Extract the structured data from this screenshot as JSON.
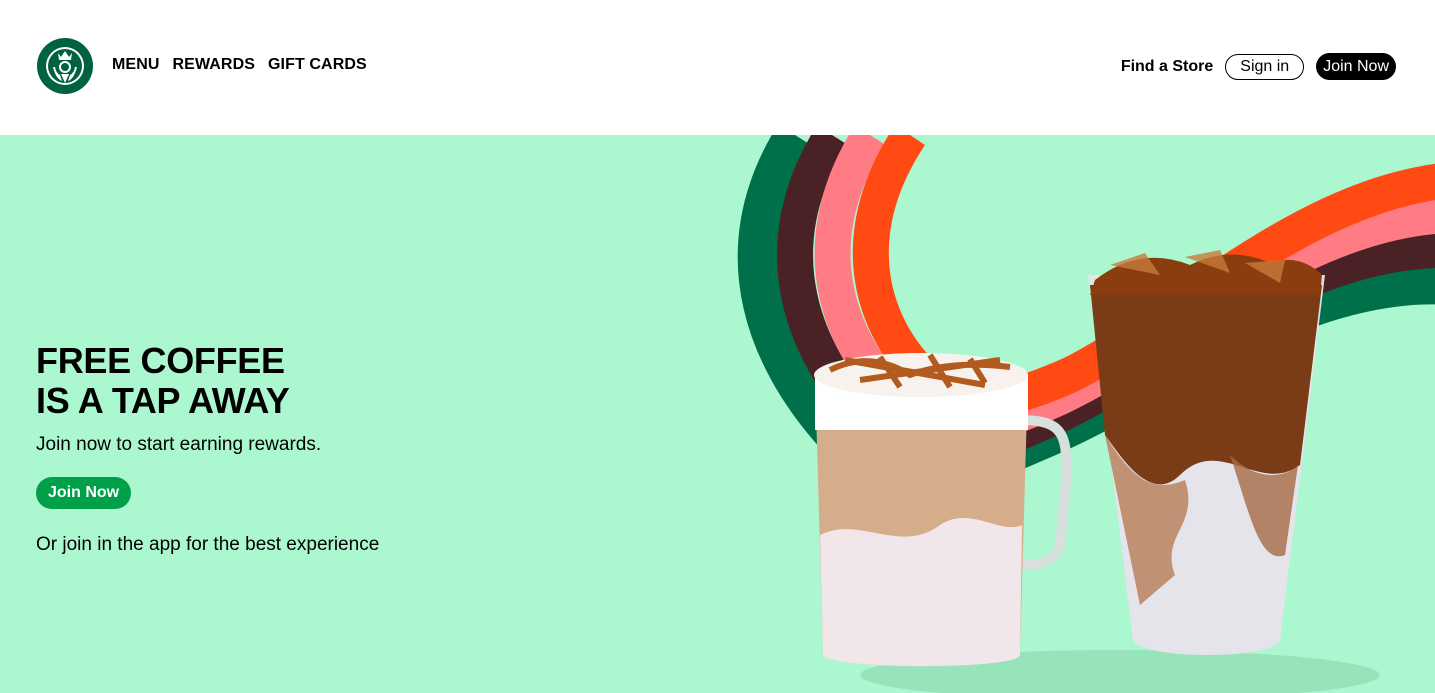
{
  "nav": {
    "items": [
      {
        "label": "MENU"
      },
      {
        "label": "REWARDS"
      },
      {
        "label": "GIFT CARDS"
      }
    ],
    "find_store": "Find a Store",
    "sign_in": "Sign in",
    "join_now": "Join Now"
  },
  "hero": {
    "headline_line1": "FREE COFFEE",
    "headline_line2": "IS A TAP AWAY",
    "subtitle": "Join now to start earning rewards.",
    "cta": "Join Now",
    "app_note": "Or join in the app for the best experience"
  },
  "colors": {
    "brand_green": "#006241",
    "cta_green": "#00a04a",
    "hero_bg": "#abf8d0",
    "stripe_green": "#00704a",
    "stripe_brown": "#4a2226",
    "stripe_pink": "#ff7c85",
    "stripe_orange": "#ff4a14"
  },
  "icons": {
    "logo": "starbucks-siren-logo",
    "store": "location-pin-icon"
  }
}
